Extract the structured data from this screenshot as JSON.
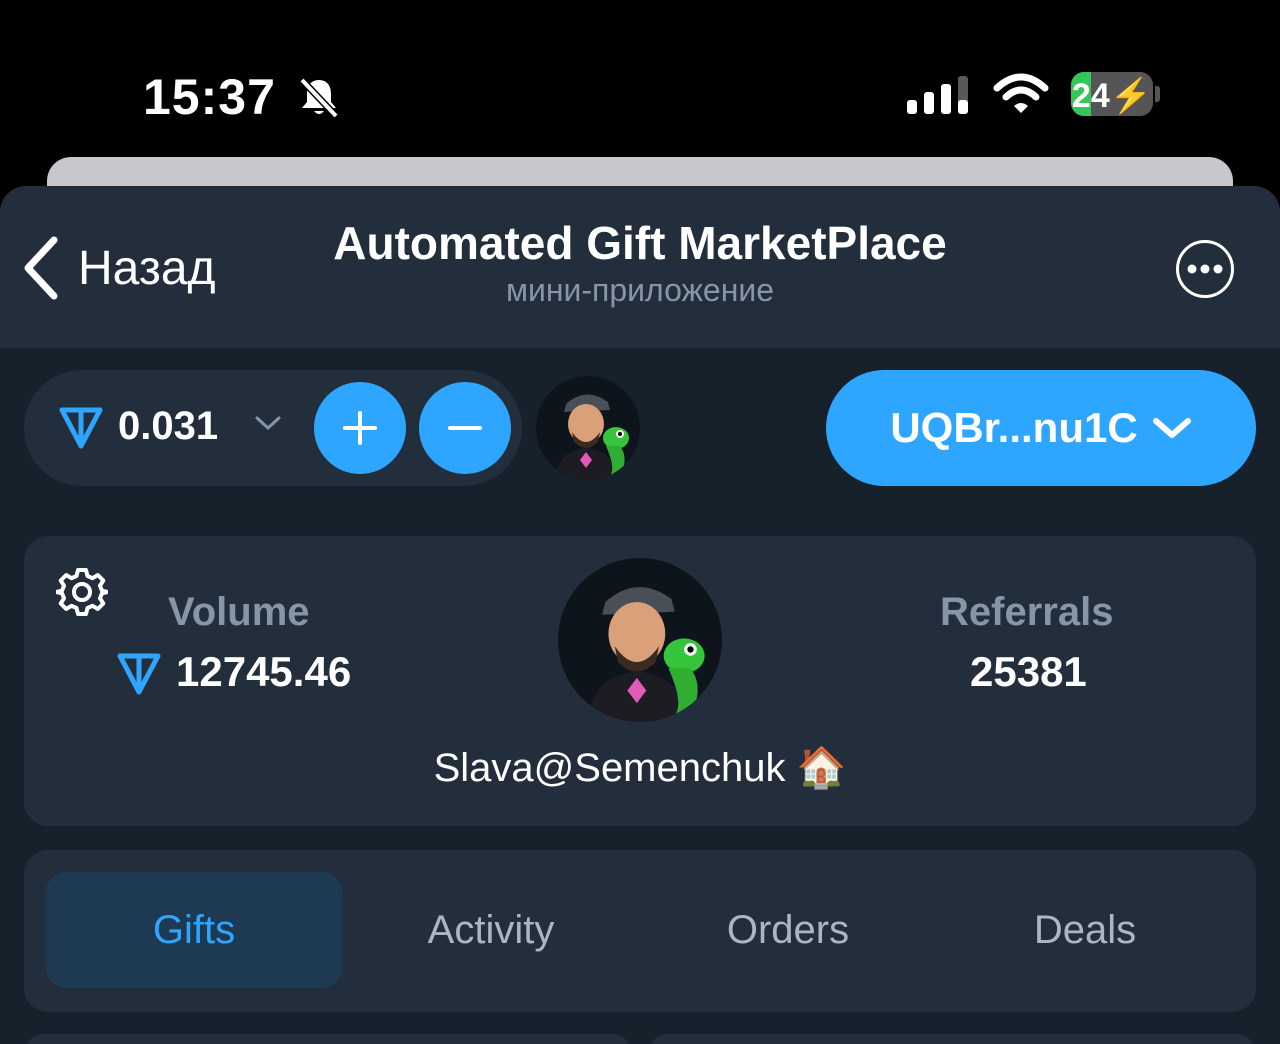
{
  "status_bar": {
    "time": "15:37",
    "battery": "24",
    "icons": [
      "bell-slash-icon",
      "signal-icon",
      "wifi-icon",
      "battery-charging-icon"
    ]
  },
  "header": {
    "back_label": "Назад",
    "title": "Automated Gift MarketPlace",
    "subtitle": "мини-приложение",
    "icons": [
      "chevron-left-icon",
      "more-icon"
    ]
  },
  "wallet": {
    "balance": "0.031",
    "address": "UQBr...nu1C",
    "icons": [
      "ton-icon",
      "chevron-down-icon",
      "plus-icon",
      "minus-icon"
    ]
  },
  "profile": {
    "volume_label": "Volume",
    "volume_value": "12745.46",
    "referrals_label": "Referrals",
    "referrals_value": "25381",
    "username": "Slava@Semenchuk 🏠",
    "icons": [
      "gear-icon",
      "avatar"
    ]
  },
  "tabs": [
    {
      "label": "Gifts",
      "active": true
    },
    {
      "label": "Activity",
      "active": false
    },
    {
      "label": "Orders",
      "active": false
    },
    {
      "label": "Deals",
      "active": false
    }
  ],
  "colors": {
    "background": "#17212b",
    "surface": "#232e3c",
    "accent": "#2ea6ff",
    "muted_text": "#8796a6",
    "active_tab_bg": "#1e3a52"
  }
}
